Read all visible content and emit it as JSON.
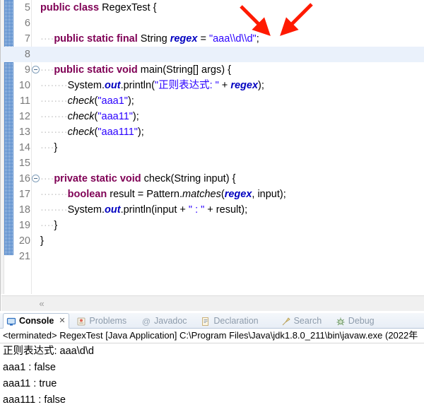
{
  "editor": {
    "lines": [
      {
        "num": "5",
        "fold": false,
        "indent": 0,
        "tokens": [
          {
            "t": "public ",
            "c": "kw"
          },
          {
            "t": "class ",
            "c": "kw"
          },
          {
            "t": "RegexTest {",
            "c": "pl"
          }
        ]
      },
      {
        "num": "6",
        "fold": false,
        "indent": 0,
        "tokens": []
      },
      {
        "num": "7",
        "fold": false,
        "indent": 1,
        "tokens": [
          {
            "t": "public static final ",
            "c": "kw"
          },
          {
            "t": "String ",
            "c": "pl"
          },
          {
            "t": "regex",
            "c": "fld"
          },
          {
            "t": " = ",
            "c": "pl"
          },
          {
            "t": "\"aaa\\\\d\\\\d\"",
            "c": "str"
          },
          {
            "t": ";",
            "c": "pl"
          }
        ]
      },
      {
        "num": "8",
        "fold": false,
        "indent": 0,
        "highlight": true,
        "tokens": []
      },
      {
        "num": "9",
        "fold": true,
        "indent": 1,
        "tokens": [
          {
            "t": "public static void ",
            "c": "kw"
          },
          {
            "t": "main(String[] args) {",
            "c": "pl"
          }
        ]
      },
      {
        "num": "10",
        "fold": false,
        "indent": 2,
        "tokens": [
          {
            "t": "System.",
            "c": "pl"
          },
          {
            "t": "out",
            "c": "fld"
          },
          {
            "t": ".println(",
            "c": "pl"
          },
          {
            "t": "\"正则表达式: \"",
            "c": "str"
          },
          {
            "t": " + ",
            "c": "pl"
          },
          {
            "t": "regex",
            "c": "fld"
          },
          {
            "t": ");",
            "c": "pl"
          }
        ]
      },
      {
        "num": "11",
        "fold": false,
        "indent": 2,
        "tokens": [
          {
            "t": "check",
            "c": "mth"
          },
          {
            "t": "(",
            "c": "pl"
          },
          {
            "t": "\"aaa1\"",
            "c": "str"
          },
          {
            "t": ");",
            "c": "pl"
          }
        ]
      },
      {
        "num": "12",
        "fold": false,
        "indent": 2,
        "tokens": [
          {
            "t": "check",
            "c": "mth"
          },
          {
            "t": "(",
            "c": "pl"
          },
          {
            "t": "\"aaa11\"",
            "c": "str"
          },
          {
            "t": ");",
            "c": "pl"
          }
        ]
      },
      {
        "num": "13",
        "fold": false,
        "indent": 2,
        "tokens": [
          {
            "t": "check",
            "c": "mth"
          },
          {
            "t": "(",
            "c": "pl"
          },
          {
            "t": "\"aaa111\"",
            "c": "str"
          },
          {
            "t": ");",
            "c": "pl"
          }
        ]
      },
      {
        "num": "14",
        "fold": false,
        "indent": 1,
        "tokens": [
          {
            "t": "}",
            "c": "pl"
          }
        ]
      },
      {
        "num": "15",
        "fold": false,
        "indent": 0,
        "tokens": []
      },
      {
        "num": "16",
        "fold": true,
        "indent": 1,
        "tokens": [
          {
            "t": "private static void ",
            "c": "kw"
          },
          {
            "t": "check(String input) {",
            "c": "pl"
          }
        ]
      },
      {
        "num": "17",
        "fold": false,
        "indent": 2,
        "tokens": [
          {
            "t": "boolean ",
            "c": "kw"
          },
          {
            "t": "result = Pattern.",
            "c": "pl"
          },
          {
            "t": "matches",
            "c": "mth"
          },
          {
            "t": "(",
            "c": "pl"
          },
          {
            "t": "regex",
            "c": "fld"
          },
          {
            "t": ", input);",
            "c": "pl"
          }
        ]
      },
      {
        "num": "18",
        "fold": false,
        "indent": 2,
        "tokens": [
          {
            "t": "System.",
            "c": "pl"
          },
          {
            "t": "out",
            "c": "fld"
          },
          {
            "t": ".println(input + ",
            "c": "pl"
          },
          {
            "t": "\" : \"",
            "c": "str"
          },
          {
            "t": " + result);",
            "c": "pl"
          }
        ]
      },
      {
        "num": "19",
        "fold": false,
        "indent": 1,
        "tokens": [
          {
            "t": "}",
            "c": "pl"
          }
        ]
      },
      {
        "num": "20",
        "fold": false,
        "indent": 0,
        "tokens": [
          {
            "t": "}",
            "c": "pl"
          }
        ]
      },
      {
        "num": "21",
        "fold": false,
        "indent": 0,
        "tokens": []
      }
    ],
    "hscroll_left_label": "«"
  },
  "annotations": {
    "arrow_color": "#ff1a00",
    "arrow_count": 2
  },
  "console": {
    "tabs": [
      {
        "label": "Console",
        "icon": "console-icon",
        "active": true,
        "closable": true,
        "close_glyph": "✕"
      },
      {
        "label": "Problems",
        "icon": "problems-icon",
        "active": false
      },
      {
        "label": "Javadoc",
        "icon": "javadoc-icon",
        "active": false
      },
      {
        "label": "Declaration",
        "icon": "declaration-icon",
        "active": false
      },
      {
        "label": "Search",
        "icon": "search-icon",
        "active": false
      },
      {
        "label": "Debug",
        "icon": "debug-icon",
        "active": false
      }
    ],
    "terminated_line": "<terminated> RegexTest [Java Application] C:\\Program Files\\Java\\jdk1.8.0_211\\bin\\javaw.exe (2022年",
    "output": [
      "正则表达式: aaa\\d\\d",
      "aaa1 : false",
      "aaa11 : true",
      "aaa111 : false"
    ]
  },
  "colors": {
    "keyword": "#7f0055",
    "string": "#2a00ff",
    "field": "#0000c0",
    "line_number": "#7a7a7a",
    "highlight_row": "#eaf1fb",
    "changebar": "#2f6fc0"
  }
}
